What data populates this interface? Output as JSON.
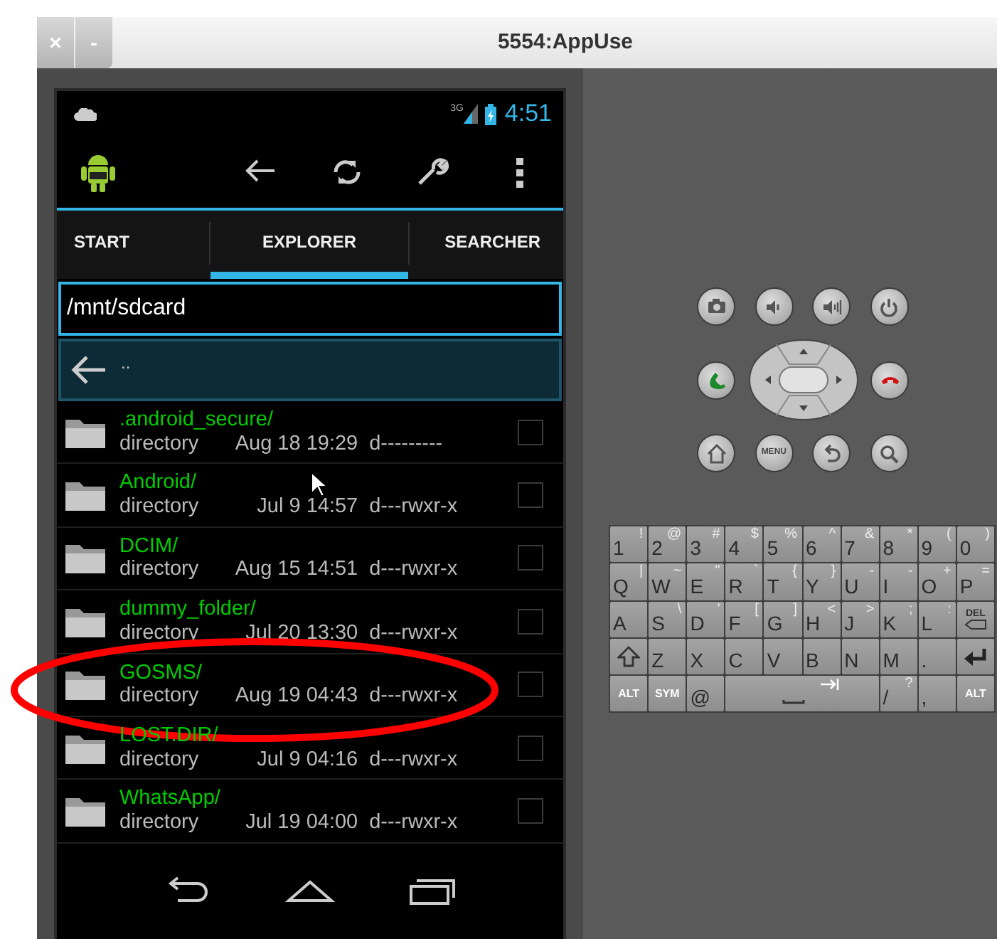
{
  "window": {
    "title": "5554:AppUse",
    "buttons": [
      "×",
      "-"
    ]
  },
  "status_bar": {
    "network": "3G",
    "time": "4:51"
  },
  "action_bar": {
    "actions": [
      {
        "kind": "back"
      },
      {
        "kind": "refresh"
      },
      {
        "kind": "settings"
      },
      {
        "kind": "overflow"
      }
    ]
  },
  "tabs": [
    {
      "label": "START",
      "selected": false
    },
    {
      "label": "EXPLORER",
      "selected": true
    },
    {
      "label": "SEARCHER",
      "selected": false
    }
  ],
  "path_field": {
    "value": "/mnt/sdcard"
  },
  "parent_row": {
    "label": ".."
  },
  "files": [
    {
      "name": ".android_secure/",
      "type": "directory",
      "date": "Aug 18 19:29",
      "permissions": "d---------",
      "checked": false,
      "highlighted": false,
      "pointer": false
    },
    {
      "name": "Android/",
      "type": "directory",
      "date": "Jul 9 14:57",
      "permissions": "d---rwxr-x",
      "checked": false,
      "highlighted": false,
      "pointer": true
    },
    {
      "name": "DCIM/",
      "type": "directory",
      "date": "Aug 15 14:51",
      "permissions": "d---rwxr-x",
      "checked": false,
      "highlighted": false,
      "pointer": false
    },
    {
      "name": "dummy_folder/",
      "type": "directory",
      "date": "Jul 20 13:30",
      "permissions": "d---rwxr-x",
      "checked": false,
      "highlighted": false,
      "pointer": false
    },
    {
      "name": "GOSMS/",
      "type": "directory",
      "date": "Aug 19 04:43",
      "permissions": "d---rwxr-x",
      "checked": false,
      "highlighted": true,
      "pointer": false
    },
    {
      "name": "LOST.DIR/",
      "type": "directory",
      "date": "Jul 9 04:16",
      "permissions": "d---rwxr-x",
      "checked": false,
      "highlighted": false,
      "pointer": false
    },
    {
      "name": "WhatsApp/",
      "type": "directory",
      "date": "Jul 19 04:00",
      "permissions": "d---rwxr-x",
      "checked": false,
      "highlighted": false,
      "pointer": false
    }
  ],
  "nav_buttons": [
    {
      "kind": "back"
    },
    {
      "kind": "home"
    },
    {
      "kind": "recents"
    }
  ],
  "hardware_buttons": [
    [
      {
        "kind": "camera"
      },
      {
        "kind": "volume_down"
      },
      {
        "kind": "volume_up"
      },
      {
        "kind": "power"
      }
    ],
    [
      {
        "kind": "call"
      },
      {
        "kind": "dpad"
      },
      {
        "kind": "end_call"
      }
    ],
    [
      {
        "kind": "home"
      },
      {
        "kind": "menu",
        "label": "MENU"
      },
      {
        "kind": "back"
      },
      {
        "kind": "search"
      }
    ]
  ],
  "keyboard": [
    [
      {
        "label": "1",
        "alt": "!"
      },
      {
        "label": "2",
        "alt": "@"
      },
      {
        "label": "3",
        "alt": "#"
      },
      {
        "label": "4",
        "alt": "$"
      },
      {
        "label": "5",
        "alt": "%"
      },
      {
        "label": "6",
        "alt": "^"
      },
      {
        "label": "7",
        "alt": "&"
      },
      {
        "label": "8",
        "alt": "*"
      },
      {
        "label": "9",
        "alt": "("
      },
      {
        "label": "0",
        "alt": ")"
      }
    ],
    [
      {
        "label": "Q",
        "alt": "|"
      },
      {
        "label": "W",
        "alt": "~"
      },
      {
        "label": "E",
        "alt": "\""
      },
      {
        "label": "R",
        "alt": "`"
      },
      {
        "label": "T",
        "alt": "{"
      },
      {
        "label": "Y",
        "alt": "}"
      },
      {
        "label": "U",
        "alt": "-"
      },
      {
        "label": "I",
        "alt": "-"
      },
      {
        "label": "O",
        "alt": "+"
      },
      {
        "label": "P",
        "alt": "="
      }
    ],
    [
      {
        "label": "A"
      },
      {
        "label": "S",
        "alt": "\\"
      },
      {
        "label": "D",
        "alt": "'"
      },
      {
        "label": "F",
        "alt": "["
      },
      {
        "label": "G",
        "alt": "]"
      },
      {
        "label": "H",
        "alt": "<"
      },
      {
        "label": "J",
        "alt": ">"
      },
      {
        "label": "K",
        "alt": ";"
      },
      {
        "label": "L",
        "alt": ":"
      },
      {
        "kind": "del",
        "label": "DEL"
      }
    ],
    [
      {
        "kind": "shift"
      },
      {
        "label": "Z"
      },
      {
        "label": "X"
      },
      {
        "label": "C"
      },
      {
        "label": "V"
      },
      {
        "label": "B"
      },
      {
        "label": "N"
      },
      {
        "label": "M"
      },
      {
        "label": "."
      },
      {
        "kind": "enter"
      }
    ],
    [
      {
        "kind": "mod",
        "label": "ALT"
      },
      {
        "kind": "mod",
        "label": "SYM"
      },
      {
        "label": "@"
      },
      {
        "kind": "space"
      },
      {
        "label": "/",
        "alt": "?"
      },
      {
        "label": ","
      },
      {
        "kind": "mod",
        "label": "ALT"
      }
    ]
  ]
}
